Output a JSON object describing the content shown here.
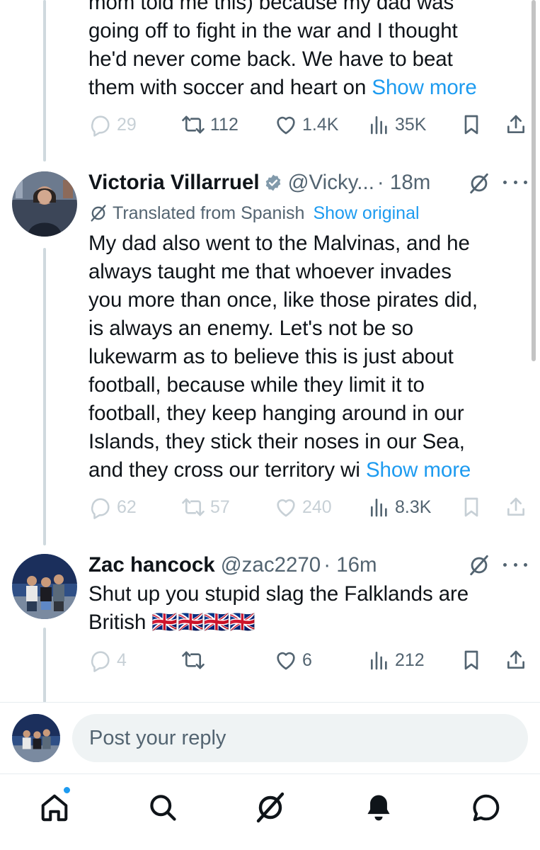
{
  "tweet1": {
    "text_lines": [
      "mom told me this) because my dad was",
      "going off to fight in the war and I thought",
      "he'd never come back. We have to beat",
      "them with soccer and heart on"
    ],
    "show_more": "Show more",
    "replies": "29",
    "reposts": "112",
    "likes": "1.4K",
    "views": "35K"
  },
  "tweet2": {
    "name": "Victoria Villarruel",
    "handle": "@Vicky...",
    "time": "· 18m",
    "translated_label": "Translated from Spanish",
    "show_original": "Show original",
    "text_lines": [
      "My dad also went to the Malvinas, and he",
      "always taught me that whoever invades",
      "you more than once, like those pirates did,",
      "is always an enemy. Let's not be so",
      "lukewarm as to believe this is just about",
      "football, because while they limit it to",
      "football, they keep hanging around in our",
      "Islands, they stick their noses in our Sea,",
      "and they cross our territory wi"
    ],
    "show_more": "Show more",
    "replies": "62",
    "reposts": "57",
    "likes": "240",
    "views": "8.3K"
  },
  "tweet3": {
    "name": "Zac hancock",
    "handle": "@zac2270",
    "time": "· 16m",
    "text_lines": [
      "Shut up you stupid slag the Falklands are",
      "British 🇬🇧🇬🇧🇬🇧🇬🇧"
    ],
    "replies": "4",
    "likes": "6",
    "views": "212"
  },
  "reply": {
    "placeholder": "Post your reply"
  },
  "nav": {
    "items": [
      "home-icon",
      "search-icon",
      "grok-icon",
      "notifications-icon",
      "messages-icon"
    ]
  },
  "colors": {
    "accent": "#1d9bf0",
    "text": "#0f1419",
    "secondary": "#536471",
    "thread_line": "#cfd9de"
  }
}
